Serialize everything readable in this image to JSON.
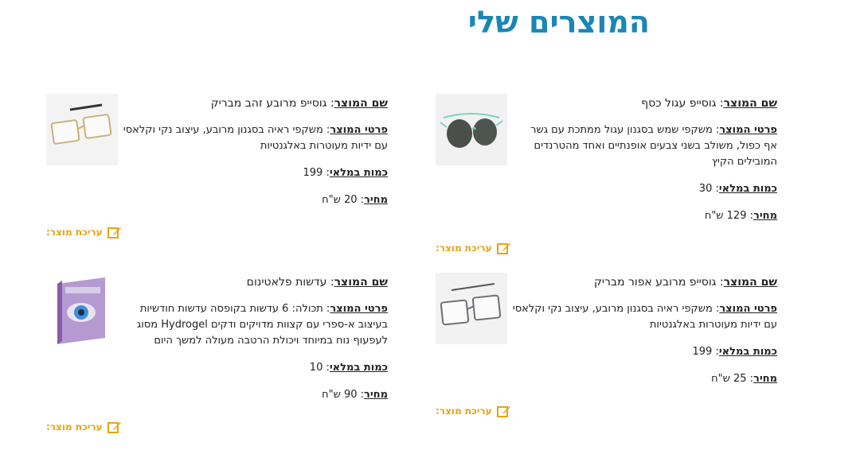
{
  "page": {
    "title": "המוצרים שלי"
  },
  "labels": {
    "name": "שם המוצר",
    "details": "פרטי המוצר",
    "stock": "כמות במלאי",
    "price": "מחיר",
    "edit": "עריכת מוצר:"
  },
  "products": [
    {
      "name": "גוסייפ עגול כסף",
      "details_lines": [
        "משקפי שמש בסגנון עגול ממתכת עם גשר",
        "אף כפול, משולב בשני צבעים אופנתיים ואחד מהטרנדים",
        "המובילים הקיץ"
      ],
      "stock": "30",
      "price": "129 ש\"ח",
      "image": "sunglasses-round-image",
      "accent": "#7fd0c8"
    },
    {
      "name": "גוסייפ מרובע זהב מבריק",
      "details_lines": [
        "משקפי ראיה בסגנון מרובע, עיצוב נקי וקלאסי",
        "עם ידיות מעוטרות באלגנטיות"
      ],
      "stock": "199",
      "price": "20 ש\"ח",
      "image": "glasses-gold-square-image",
      "accent": "#c9b27a"
    },
    {
      "name": "גוסייפ מרובע אפור מבריק",
      "details_lines": [
        "משקפי ראיה בסגנון מרובע, עיצוב נקי וקלאסי",
        "עם ידיות מעוטרות באלגנטיות"
      ],
      "stock": "199",
      "price": "25 ש\"ח",
      "image": "glasses-gray-square-image",
      "accent": "#6e6e74"
    },
    {
      "name": "עדשות פלאטינום",
      "details_lines": [
        "תכולה: 6 עדשות בקופסה עדשות חודשיות",
        "בעיצוב א-ספרי עם קצוות מדויקים ודקים Hydrogel מסוג",
        "לעפעוף נוח במיוחד ויכולת הרטבה מעולה למשך היום"
      ],
      "stock": "10",
      "price": "90 ש\"ח",
      "image": "contact-lens-box-image",
      "accent": "#8a5aa8"
    }
  ],
  "colors": {
    "title": "#1b86b4",
    "edit": "#e8a312"
  }
}
